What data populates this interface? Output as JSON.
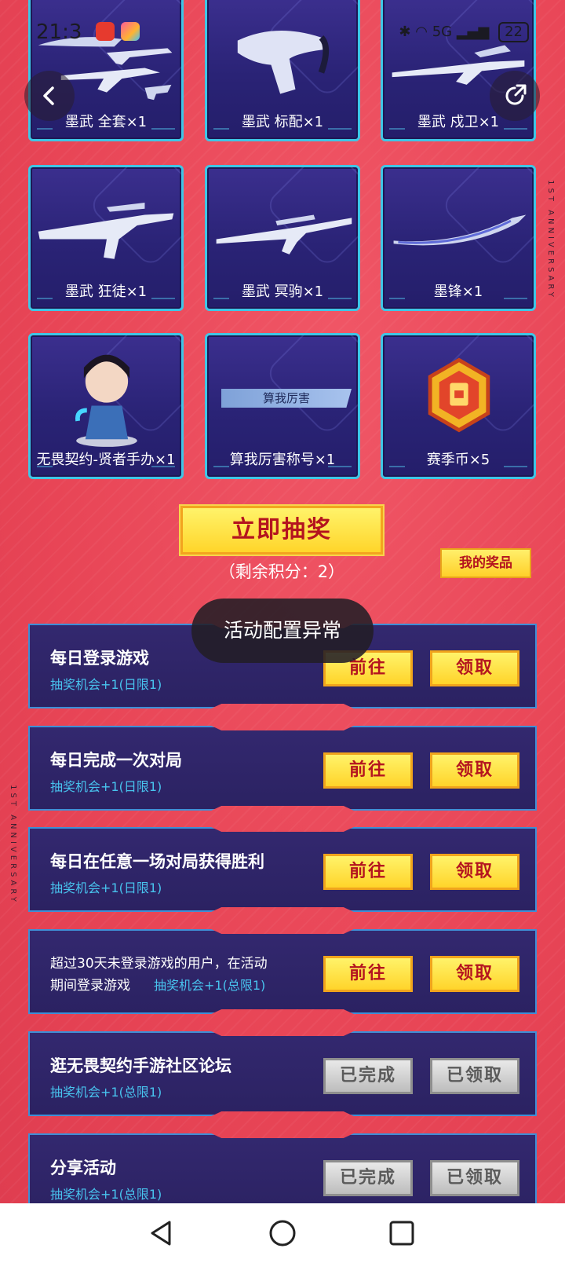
{
  "status_bar": {
    "time": "21:3",
    "network": "5G",
    "battery": "22"
  },
  "prizes": [
    {
      "label": "墨武 全套×1",
      "icon": "weapon-set-icon"
    },
    {
      "label": "墨武 标配×1",
      "icon": "pistol-icon"
    },
    {
      "label": "墨武 戍卫×1",
      "icon": "rifle-icon"
    },
    {
      "label": "墨武 狂徒×1",
      "icon": "rifle-icon"
    },
    {
      "label": "墨武 冥驹×1",
      "icon": "sniper-icon"
    },
    {
      "label": "墨锋×1",
      "icon": "blade-icon"
    },
    {
      "label": "无畏契约-贤者手办×1",
      "icon": "figure-icon"
    },
    {
      "label": "算我厉害称号×1",
      "icon": "title-badge-icon",
      "banner": "算我厉害"
    },
    {
      "label": "赛季币×5",
      "icon": "coin-icon"
    }
  ],
  "draw": {
    "button_label": "立即抽奖",
    "remaining": "（剩余积分：2）",
    "my_prizes": "我的奖品"
  },
  "toast": "活动配置异常",
  "tasks": [
    {
      "title": "每日登录游戏",
      "sub": "抽奖机会+1(日限1)",
      "go": "前往",
      "get": "领取",
      "state": "active"
    },
    {
      "title": "每日完成一次对局",
      "sub": "抽奖机会+1(日限1)",
      "go": "前往",
      "get": "领取",
      "state": "active"
    },
    {
      "title": "每日在任意一场对局获得胜利",
      "sub": "抽奖机会+1(日限1)",
      "go": "前往",
      "get": "领取",
      "state": "active"
    },
    {
      "title_line1": "超过30天未登录游戏的用户，在活动",
      "title_line2": "期间登录游戏",
      "sub": "抽奖机会+1(总限1)",
      "go": "前往",
      "get": "领取",
      "state": "active"
    },
    {
      "title": "逛无畏契约手游社区论坛",
      "sub": "抽奖机会+1(总限1)",
      "go": "已完成",
      "get": "已领取",
      "state": "done"
    },
    {
      "title": "分享活动",
      "sub": "抽奖机会+1(总限1)",
      "go": "已完成",
      "get": "已领取",
      "state": "done"
    }
  ],
  "edge_text": "1ST ANNIVERSARY",
  "colors": {
    "accent_yellow": "#ffd52a",
    "text_red": "#b4141f",
    "card_border": "#3fc6e6",
    "sub_blue": "#48c3ee"
  }
}
